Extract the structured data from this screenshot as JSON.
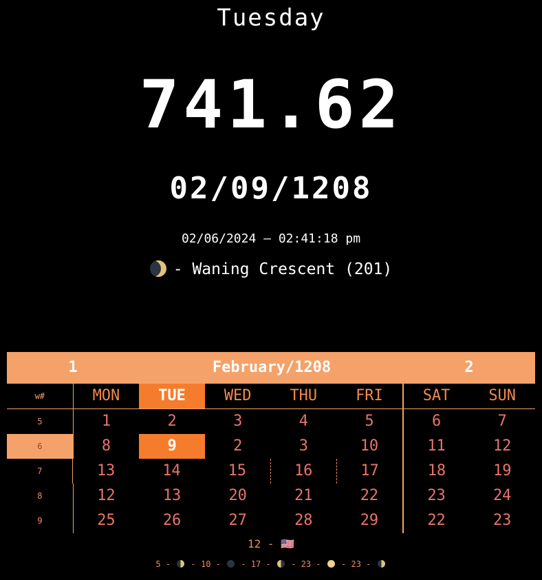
{
  "weekday": "Tuesday",
  "clock": "741.62",
  "alt_date": "02/09/1208",
  "std_datetime": "02/06/2024 — 02:41:18 pm",
  "moon": {
    "icon": "waning-crescent-moon-icon",
    "text": "- Waning Crescent (201)"
  },
  "calendar": {
    "week_left": "1",
    "month_label": "February/1208",
    "week_right": "2",
    "header": {
      "wn": "w#",
      "days": [
        "MON",
        "TUE",
        "WED",
        "THU",
        "FRI",
        "SAT",
        "SUN"
      ]
    },
    "rows": [
      {
        "wn": "5",
        "days": [
          "1",
          "2",
          "3",
          "4",
          "5",
          "6",
          "7"
        ]
      },
      {
        "wn": "6",
        "days": [
          "8",
          "9",
          "2",
          "3",
          "10",
          "11",
          "12"
        ]
      },
      {
        "wn": "7",
        "days": [
          "13",
          "14",
          "15",
          "16",
          "17",
          "18",
          "19"
        ]
      },
      {
        "wn": "8",
        "days": [
          "12",
          "13",
          "20",
          "21",
          "22",
          "23",
          "24"
        ]
      },
      {
        "wn": "9",
        "days": [
          "25",
          "26",
          "27",
          "28",
          "29",
          "22",
          "23"
        ]
      }
    ]
  },
  "holiday": "12 - 🇺🇸",
  "phases": {
    "items": [
      "5 -",
      "- 10 -",
      "- 17 -",
      "- 23 -",
      "- 23 -"
    ]
  },
  "colors": {
    "accent": "#f4a26a",
    "today": "#f57c2c",
    "text_orange": "#f08a6a"
  }
}
